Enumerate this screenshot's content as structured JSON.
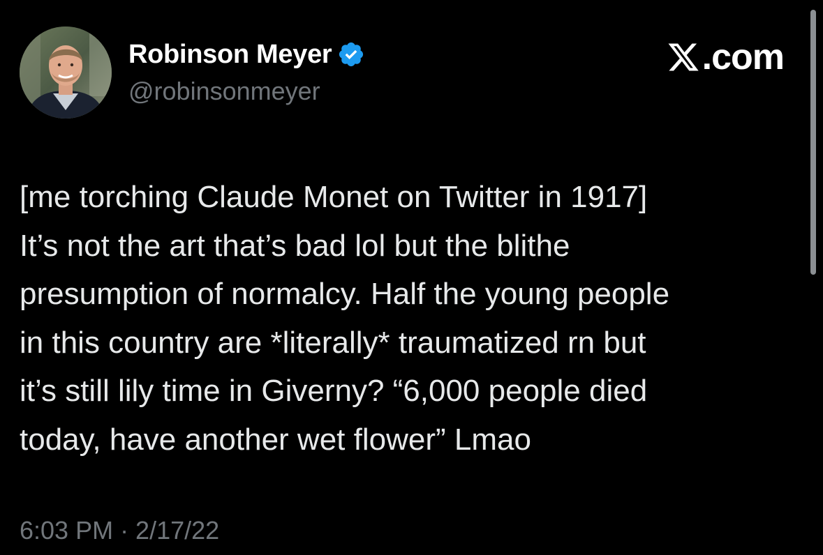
{
  "author": {
    "display_name": "Robinson Meyer",
    "handle": "@robinsonmeyer",
    "verified": true,
    "verified_icon": "verified-badge-icon",
    "avatar": "profile-photo"
  },
  "brand": {
    "logo_icon": "x-logo-icon",
    "suffix": ".com"
  },
  "tweet": {
    "lines": [
      "[me torching Claude Monet on Twitter in 1917]",
      "It’s not the art that’s bad lol but the blithe",
      "presumption of normalcy. Half the young people",
      "in this country are *literally* traumatized rn but",
      "it’s still lily time in Giverny? “6,000 people died",
      "today, have another wet flower” Lmao"
    ],
    "timestamp": "6:03 PM · 2/17/22"
  },
  "colors": {
    "background": "#000000",
    "text_primary": "#e7e9ea",
    "text_secondary": "#71767b",
    "verified_blue": "#1d9bf0"
  }
}
